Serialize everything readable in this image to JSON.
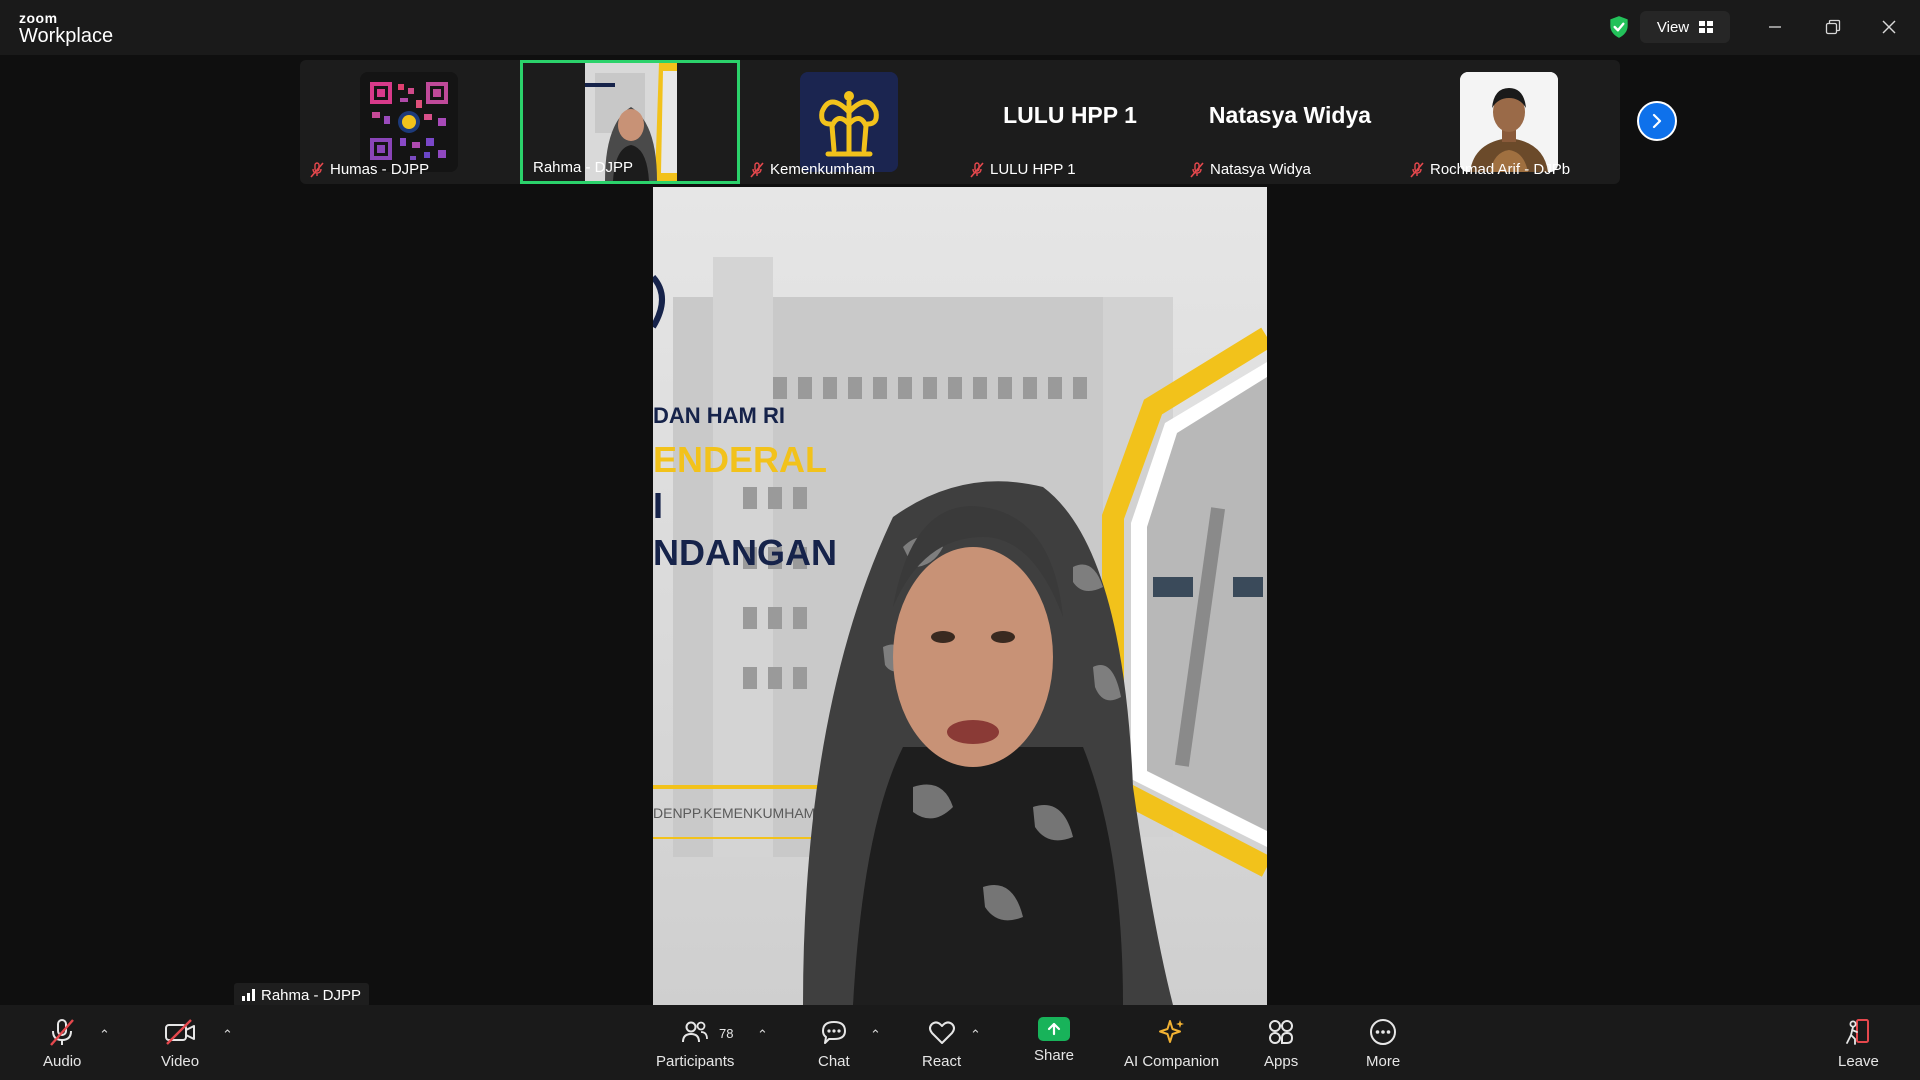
{
  "app": {
    "logo_top": "zoom",
    "logo_bottom": "Workplace",
    "view_label": "View"
  },
  "thumbnails": [
    {
      "name": "Humas - DJPP",
      "muted": true,
      "display": "image"
    },
    {
      "name": "Rahma - DJPP",
      "muted": false,
      "display": "video",
      "active": true
    },
    {
      "name": "Kemenkumham",
      "muted": true,
      "display": "logo"
    },
    {
      "name": "LULU HPP 1",
      "muted": true,
      "display": "text",
      "big_name": "LULU HPP 1"
    },
    {
      "name": "Natasya Widya",
      "muted": true,
      "display": "text",
      "big_name": "Natasya Widya"
    },
    {
      "name": "Rochmad Arif - DJPb",
      "muted": true,
      "display": "photo"
    }
  ],
  "main_video": {
    "speaker_label": "Rahma - DJPP",
    "banner_lines": [
      "DAN HAM RI",
      "ENDERAL",
      "I",
      "NDANGAN"
    ],
    "website_text": "DENPP.KEMENKUMHAM.G"
  },
  "toolbar": {
    "audio": "Audio",
    "video": "Video",
    "participants": "Participants",
    "participant_count": "78",
    "chat": "Chat",
    "react": "React",
    "share": "Share",
    "ai_companion": "AI Companion",
    "apps": "Apps",
    "more": "More",
    "leave": "Leave"
  },
  "colors": {
    "active_border": "#2bd26b",
    "share_green": "#18b35a",
    "next_blue": "#0e71eb",
    "muted_red": "#e5484d",
    "leave_red": "#e5484d",
    "banner_yellow": "#f2c21b",
    "banner_navy": "#16234a"
  }
}
